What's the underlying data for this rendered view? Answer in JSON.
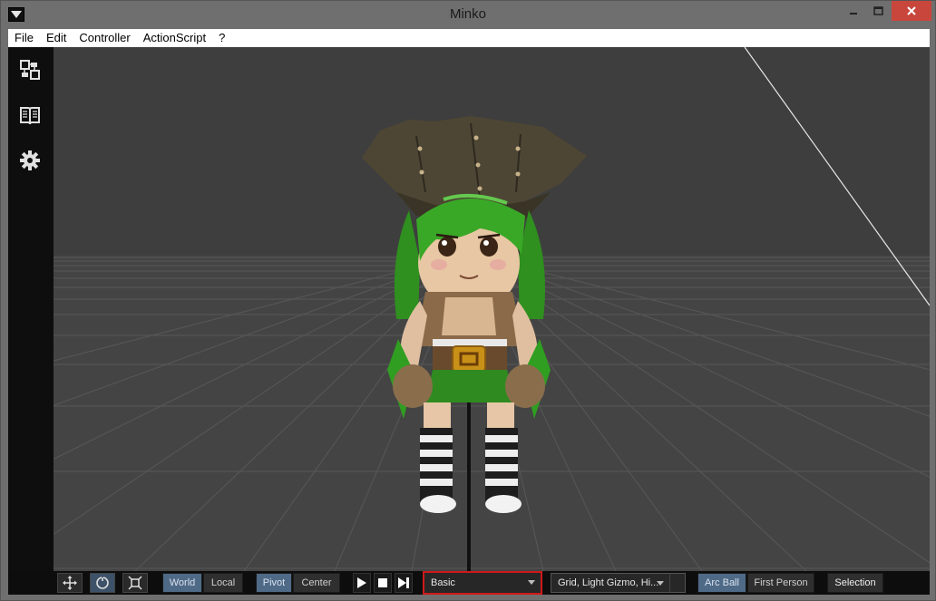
{
  "window": {
    "title": "Minko"
  },
  "menu": {
    "items": [
      "File",
      "Edit",
      "Controller",
      "ActionScript",
      "?"
    ]
  },
  "sidebar": {
    "items": [
      {
        "name": "scene-graph",
        "icon": "tree-icon"
      },
      {
        "name": "library",
        "icon": "book-icon"
      },
      {
        "name": "settings",
        "icon": "gear-icon"
      }
    ]
  },
  "toolbar": {
    "transform_tools": [
      "translate-icon",
      "rotate-icon",
      "scale-icon"
    ],
    "space": {
      "world": "World",
      "local": "Local"
    },
    "pivot": {
      "pivot": "Pivot",
      "center": "Center"
    },
    "playback": [
      "play-icon",
      "stop-icon",
      "step-icon"
    ],
    "render_mode": {
      "selected": "Basic"
    },
    "display_options": {
      "selected": "Grid, Light Gizmo, Hi..."
    },
    "camera": {
      "arcball": "Arc Ball",
      "first_person": "First Person"
    },
    "selection": "Selection"
  },
  "colors": {
    "accent": "#4f6a87",
    "highlight": "#d01818",
    "close_button": "#c9463d",
    "viewport_bg": "#3e3e3e"
  }
}
